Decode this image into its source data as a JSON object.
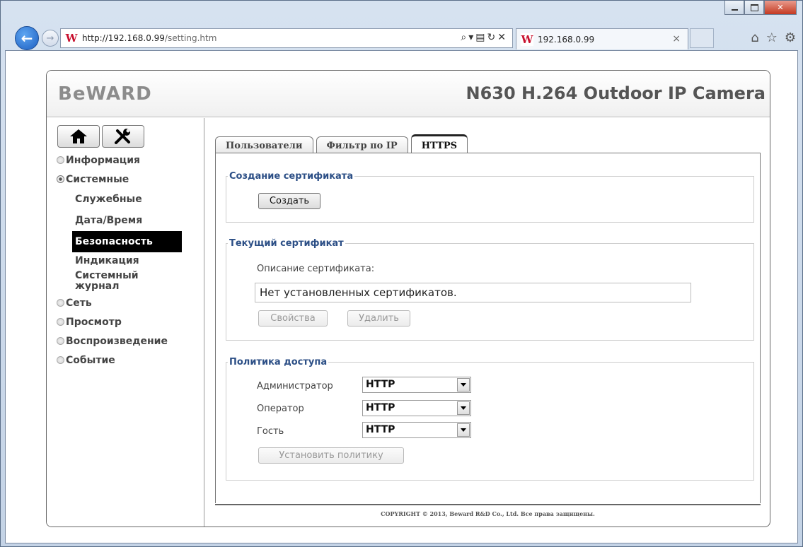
{
  "browser": {
    "url_host": "http://192.168.0.99",
    "url_path": "/setting.htm",
    "tab_title": "192.168.0.99"
  },
  "header": {
    "logo": "BeWARD",
    "model": "N630 H.264 Outdoor IP Camera"
  },
  "sidebar": {
    "items": [
      {
        "label": "Информация"
      },
      {
        "label": "Системные"
      },
      {
        "label": "Сеть"
      },
      {
        "label": "Просмотр"
      },
      {
        "label": "Воспроизведение"
      },
      {
        "label": "Событие"
      }
    ],
    "sub_items": [
      {
        "label": "Служебные"
      },
      {
        "label": "Дата/Время"
      },
      {
        "label": "Безопасность"
      },
      {
        "label": "Индикация"
      },
      {
        "label": "Системный журнал"
      }
    ]
  },
  "tabs": [
    {
      "label": "Пользователи"
    },
    {
      "label": "Фильтр по IP"
    },
    {
      "label": "HTTPS"
    }
  ],
  "create_section": {
    "legend": "Создание сертификата",
    "create_button": "Создать"
  },
  "current_section": {
    "legend": "Текущий сертификат",
    "description_label": "Описание сертификата:",
    "description_value": "Нет установленных сертификатов.",
    "properties_button": "Свойства",
    "delete_button": "Удалить"
  },
  "policy_section": {
    "legend": "Политика доступа",
    "rows": [
      {
        "label": "Администратор",
        "value": "HTTP"
      },
      {
        "label": "Оператор",
        "value": "HTTP"
      },
      {
        "label": "Гость",
        "value": "HTTP"
      }
    ],
    "apply_button": "Установить политику"
  },
  "footer": {
    "copyright": "COPYRIGHT © 2013, Beward R&D Co., Ltd. Все права защищены."
  }
}
